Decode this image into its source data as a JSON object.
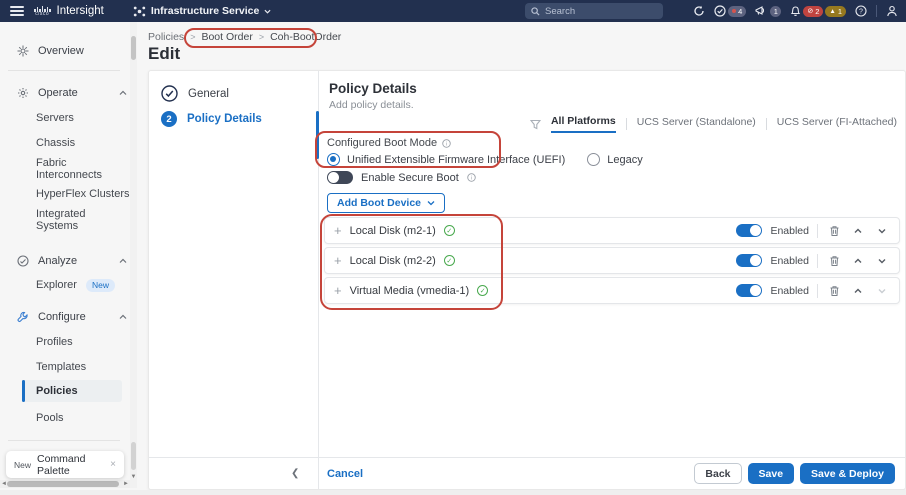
{
  "colors": {
    "header_bg": "#22304f",
    "accent_blue": "#1a6fc4",
    "annotation_red": "#c5443a",
    "success_green": "#49a94e",
    "critical_badge": "#bf4440",
    "warning_badge": "#96791f",
    "neutral_badge": "#5d6380"
  },
  "header": {
    "brand": "Intersight",
    "logo": "cisco",
    "service_name": "Infrastructure Service",
    "search": {
      "placeholder": "Search"
    },
    "badges": {
      "tasks": "4",
      "announcements": "1",
      "alarms_critical": "2",
      "alarms_warning": "1"
    }
  },
  "breadcrumb": {
    "items": [
      "Policies",
      "Boot Order",
      "Coh-BootOrder"
    ],
    "separator": ">"
  },
  "page": {
    "title": "Edit"
  },
  "sidebar": {
    "overview": "Overview",
    "sections": [
      {
        "label": "Operate",
        "items": [
          "Servers",
          "Chassis",
          "Fabric Interconnects",
          "HyperFlex Clusters",
          "Integrated Systems"
        ]
      },
      {
        "label": "Analyze",
        "items": [
          "Explorer"
        ],
        "item_badge": "New"
      },
      {
        "label": "Configure",
        "items": [
          "Profiles",
          "Templates",
          "Policies",
          "Pools"
        ],
        "active_item": "Policies"
      }
    ],
    "command_palette": {
      "badge": "New",
      "label": "Command Palette",
      "close": "×"
    }
  },
  "wizard": {
    "steps": [
      {
        "number": "1",
        "label": "General",
        "state": "complete"
      },
      {
        "number": "2",
        "label": "Policy Details",
        "state": "active"
      }
    ]
  },
  "content": {
    "title": "Policy Details",
    "subtitle": "Add policy details.",
    "tabs": [
      {
        "label": "All Platforms",
        "active": true
      },
      {
        "label": "UCS Server (Standalone)",
        "active": false
      },
      {
        "label": "UCS Server (FI-Attached)",
        "active": false
      }
    ],
    "boot_mode": {
      "label": "Configured Boot Mode",
      "options": [
        {
          "label": "Unified Extensible Firmware Interface (UEFI)",
          "selected": true
        },
        {
          "label": "Legacy",
          "selected": false
        }
      ]
    },
    "secure_boot": {
      "label": "Enable Secure Boot",
      "enabled": false
    },
    "add_device_button": "Add Boot Device",
    "devices": [
      {
        "name": "Local Disk (m2-1)",
        "toggle_label": "Enabled",
        "enabled": true
      },
      {
        "name": "Local Disk (m2-2)",
        "toggle_label": "Enabled",
        "enabled": true
      },
      {
        "name": "Virtual Media (vmedia-1)",
        "toggle_label": "Enabled",
        "enabled": true
      }
    ]
  },
  "footer": {
    "cancel": "Cancel",
    "back": "Back",
    "save": "Save",
    "save_deploy": "Save & Deploy"
  }
}
